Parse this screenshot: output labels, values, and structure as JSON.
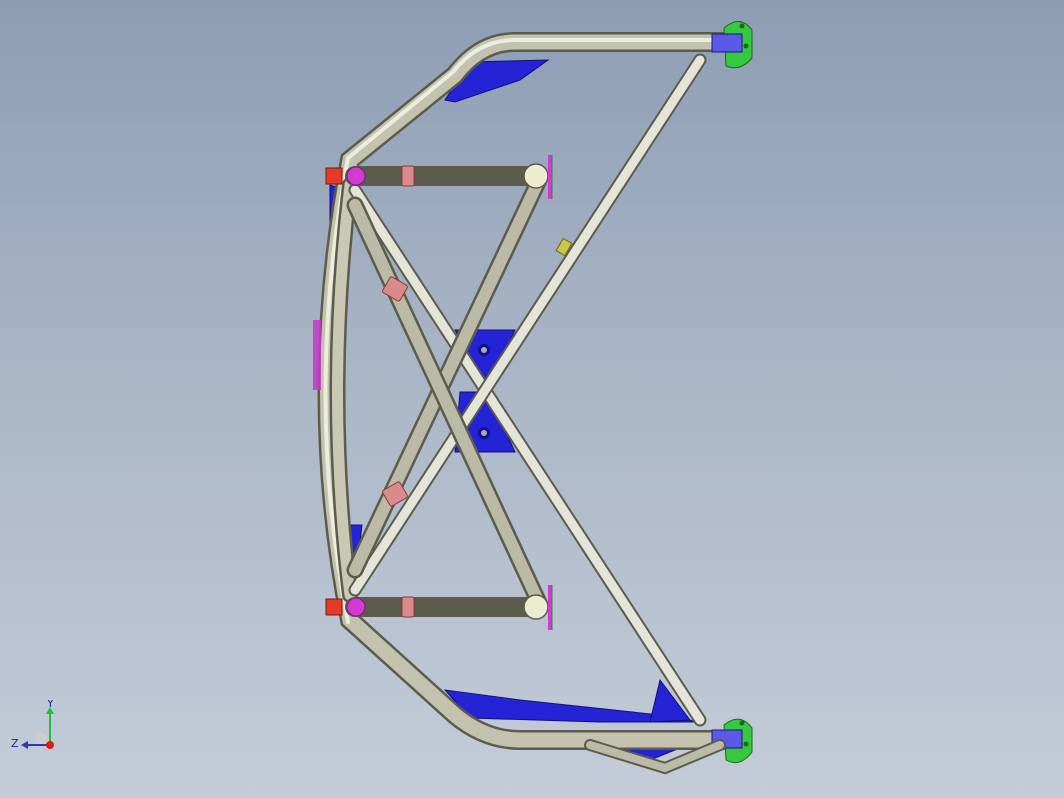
{
  "triad": {
    "y_label": "Y",
    "z_label": "Z"
  },
  "colors": {
    "background_top": "#8e9db4",
    "background_bottom": "#c4ccd8",
    "tube": "#b9b9a6",
    "tube_dark": "#7f7f6e",
    "gusset": "#2323d8",
    "end_plate": "#36c940",
    "clamp": "#d98a8a",
    "joint": "#d23ad2",
    "cap": "#e43a2a",
    "tab": "#c8c84a"
  },
  "model": {
    "parts": [
      "main-hoop",
      "upper-crossbar",
      "lower-crossbar",
      "x-brace",
      "diagonal-brace",
      "gussets",
      "mounting-plates"
    ]
  }
}
